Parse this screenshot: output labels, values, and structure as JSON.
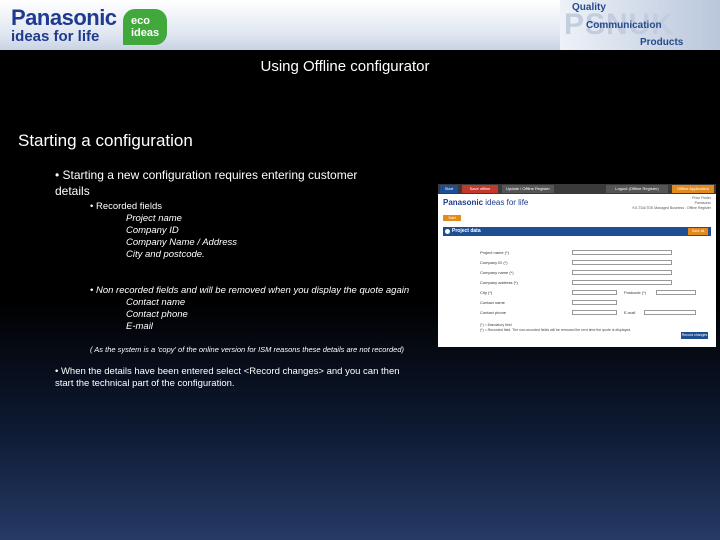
{
  "header": {
    "brand_name": "Panasonic",
    "brand_tagline": "ideas for life",
    "eco_line1": "eco",
    "eco_line2": "ideas",
    "psnuk": "PSNUK",
    "psnuk_line1": "Quality",
    "psnuk_line2": "Communication",
    "psnuk_line3": "Products"
  },
  "slide": {
    "title": "Using Offline configurator",
    "section_heading": "Starting a configuration",
    "bullet1": "• Starting a new configuration requires entering customer",
    "bullet1_cont": "details",
    "sub_recorded": "• Recorded fields",
    "recorded_fields": [
      "Project name",
      "Company ID",
      "Company Name / Address",
      "City and postcode."
    ],
    "sub_nonrecorded": "• Non recorded fields and will be removed when you display the quote again",
    "nonrecorded_fields": [
      "Contact name",
      "Contact phone",
      "E-mail"
    ],
    "note": "( As the system is a 'copy' of the online version for ISM reasons these details are not recorded)",
    "bullet2": "• When the details have been entered select <Record changes> and you can then",
    "bullet2_cont": "start the technical part of the configuration."
  },
  "screenshot": {
    "tabs": [
      {
        "label": "Start",
        "color": "#1e4f93"
      },
      {
        "label": "Save offline",
        "color": "#c0392b"
      },
      {
        "label": "Update / Offline Register",
        "color": "#555555"
      },
      {
        "label": "Logout (Offline Register)",
        "color": "#555555"
      },
      {
        "label": "Offline Application",
        "color": "#e38a1f"
      }
    ],
    "logo_brand": "Panasonic",
    "logo_tagline": "ideas for life",
    "right_info": [
      "Price Finder",
      "Panasonic",
      "KX-TDA/TDE Managed Business : Offline Register"
    ],
    "start_button": "Start",
    "section_bar": "Project data",
    "section_button": "Save all",
    "fields_left": [
      "Project name (*)",
      "Company ID (*)",
      "Company name (*)",
      "Company address (*)",
      "City (*)",
      "Contact name",
      "Contact phone"
    ],
    "fields_right": [
      "Postcode (*)",
      "E-mail"
    ],
    "footer_lines": [
      "(*) = Mandatory field",
      "(*) = Recorded field. The non-recorded fields will be removed the next time the quote is displayed."
    ],
    "record_button": "Record changes"
  }
}
